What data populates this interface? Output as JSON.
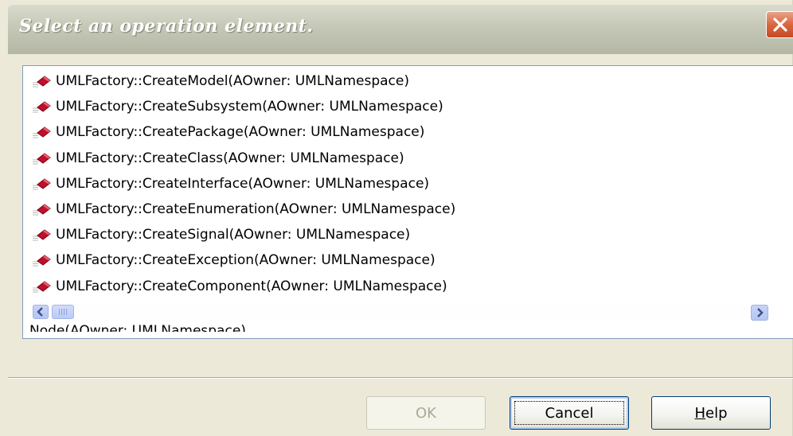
{
  "dialog": {
    "title": "Select an operation element.",
    "close_label": "close"
  },
  "operations": [
    "UMLFactory::CreateModel(AOwner: UMLNamespace)",
    "UMLFactory::CreateSubsystem(AOwner: UMLNamespace)",
    "UMLFactory::CreatePackage(AOwner: UMLNamespace)",
    "UMLFactory::CreateClass(AOwner: UMLNamespace)",
    "UMLFactory::CreateInterface(AOwner: UMLNamespace)",
    "UMLFactory::CreateEnumeration(AOwner: UMLNamespace)",
    "UMLFactory::CreateSignal(AOwner: UMLNamespace)",
    "UMLFactory::CreateException(AOwner: UMLNamespace)",
    "UMLFactory::CreateComponent(AOwner: UMLNamespace)"
  ],
  "cutoff_item": "Node(AOwner: UMLNamespace)",
  "buttons": {
    "ok": "OK",
    "cancel": "Cancel",
    "help_first": "H",
    "help_rest": "elp"
  },
  "colors": {
    "dialog_bg": "#ece9d8",
    "title_text": "#ffffff",
    "close_red": "#d9673f",
    "list_border": "#7f9db9",
    "icon_red": "#c0102a"
  },
  "icons": [
    "operation-icon",
    "close-icon",
    "scroll-left-icon",
    "scroll-right-icon"
  ]
}
